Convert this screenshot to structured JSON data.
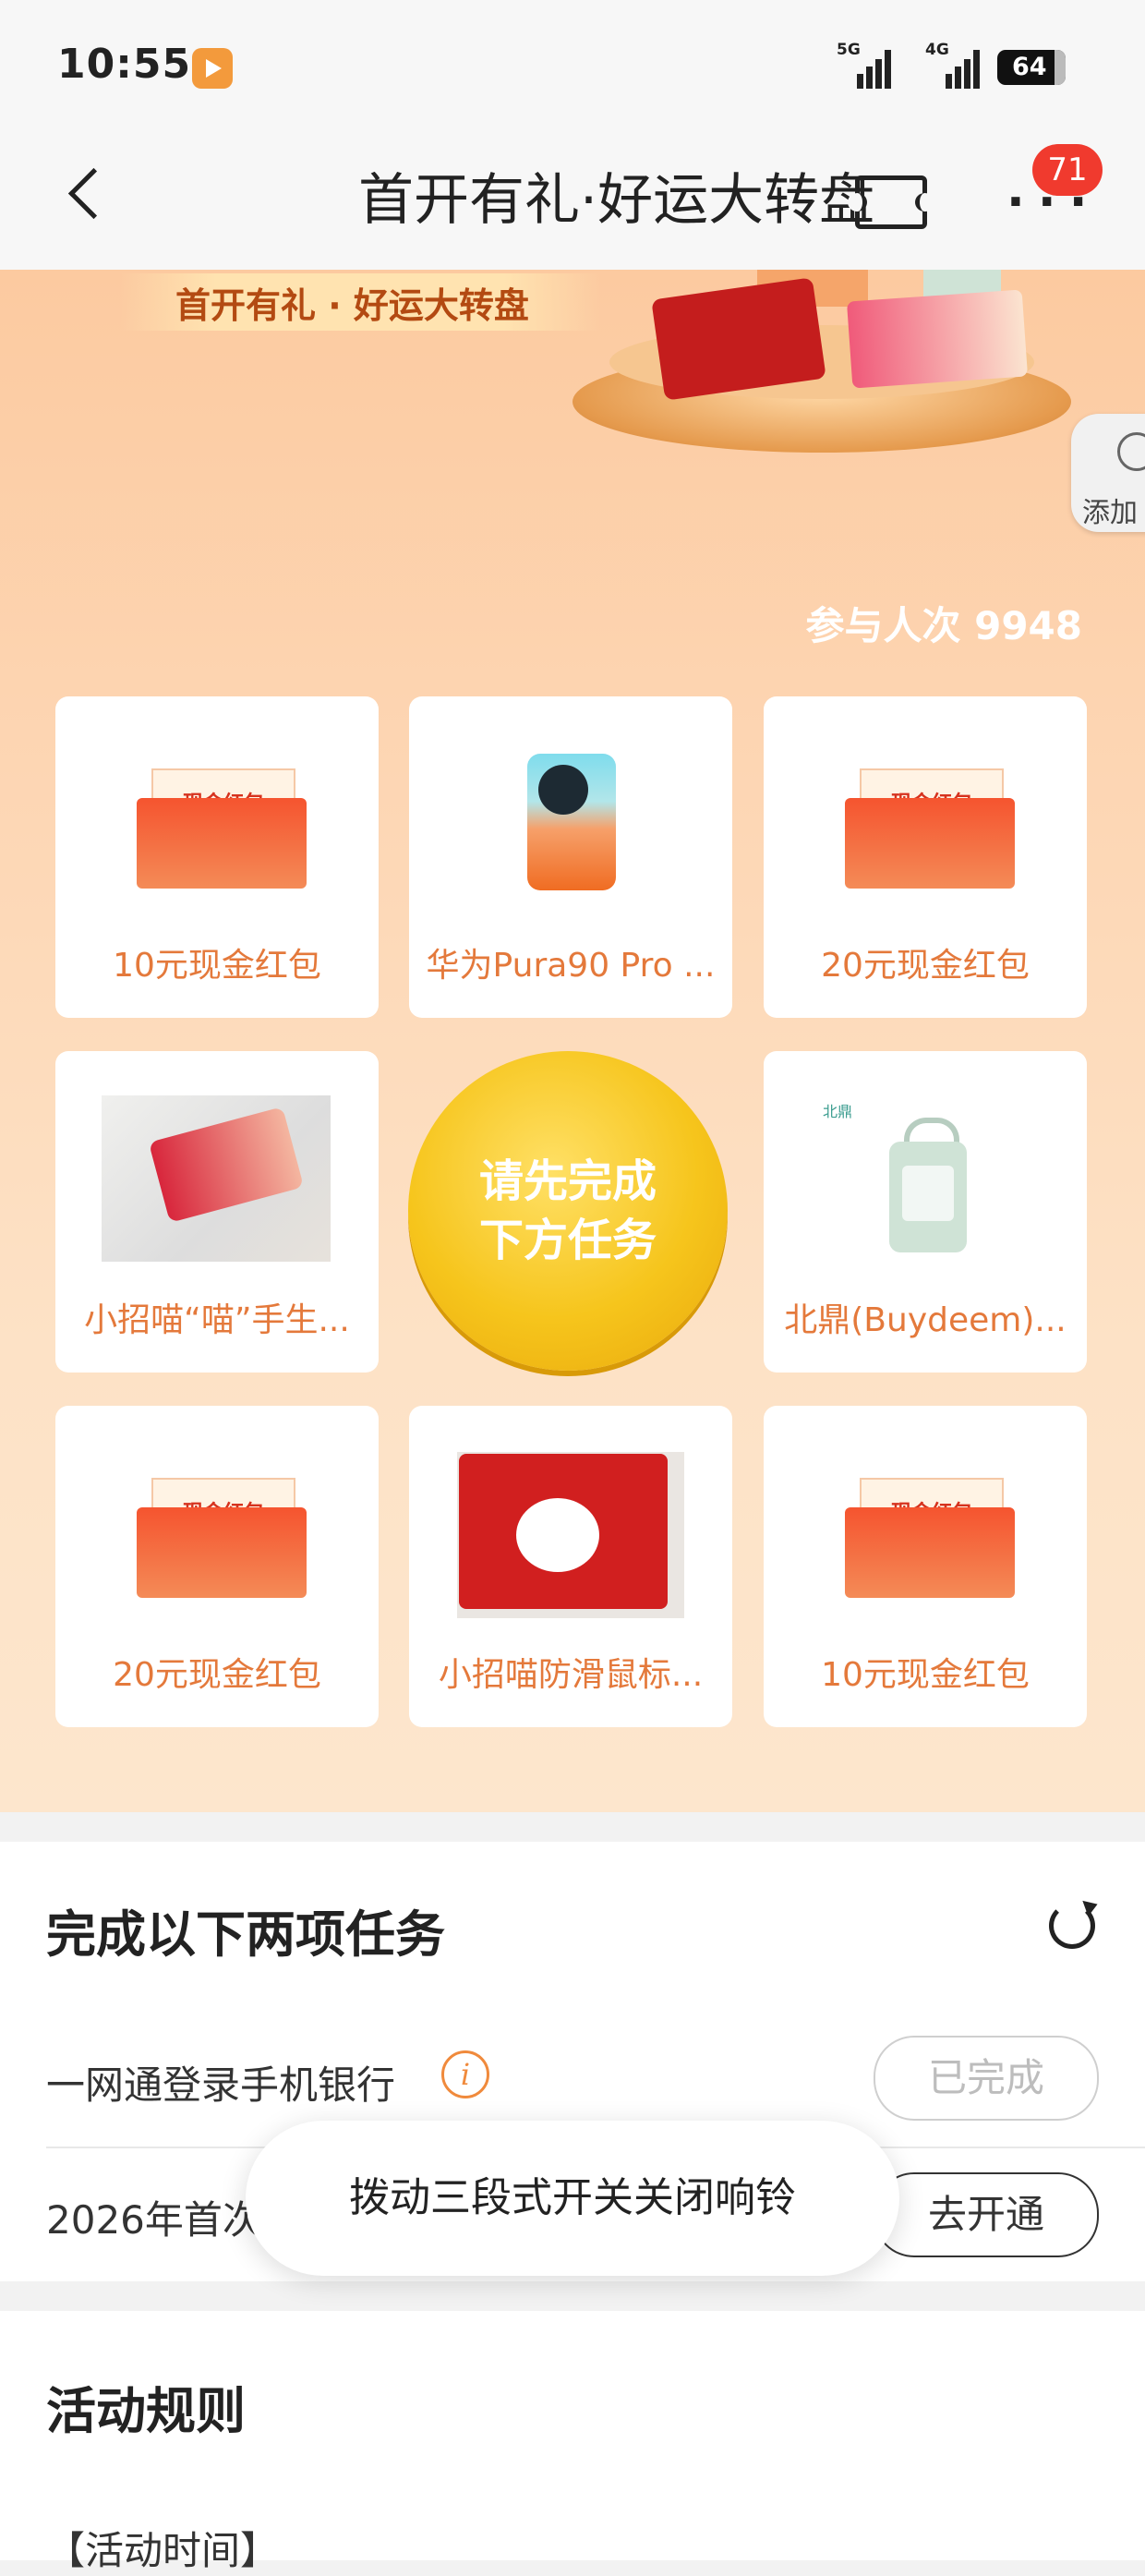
{
  "status_bar": {
    "time": "10:55",
    "signal_1_tag": "5G",
    "signal_2_tag": "4G",
    "battery": "64"
  },
  "nav": {
    "title": "首开有礼·好运大转盘",
    "notification_count": "71"
  },
  "hero": {
    "banner_title": "首开有礼 · 好运大转盘",
    "float_add_label": "添加",
    "participants": "参与人次 9948"
  },
  "prizes": [
    {
      "label": "10元现金红包",
      "envelope_text": "现金红包"
    },
    {
      "label": "华为Pura90 Pro ..."
    },
    {
      "label": "20元现金红包",
      "envelope_text": "现金红包"
    },
    {
      "label": "小招喵“喵”手生..."
    },
    {
      "label": "北鼎(Buydeem)...",
      "brand": "北鼎"
    },
    {
      "label": "20元现金红包",
      "envelope_text": "现金红包"
    },
    {
      "label": "小招喵防滑鼠标..."
    },
    {
      "label": "10元现金红包",
      "envelope_text": "现金红包"
    }
  ],
  "spin_button": {
    "label": "请先完成下方任务"
  },
  "tasks": {
    "heading": "完成以下两项任务",
    "items": [
      {
        "label": "一网通登录手机银行",
        "button": "已完成"
      },
      {
        "label": "2026年首次",
        "button": "去开通"
      }
    ]
  },
  "toast": "拨动三段式开关关闭响铃",
  "rules": {
    "heading": "活动规则",
    "section_1": "【活动时间】"
  },
  "colors": {
    "accent": "#e4793b",
    "badge": "#f03a2e",
    "spin": "#f6c51c",
    "hero_bg": "#fdd5b2"
  }
}
